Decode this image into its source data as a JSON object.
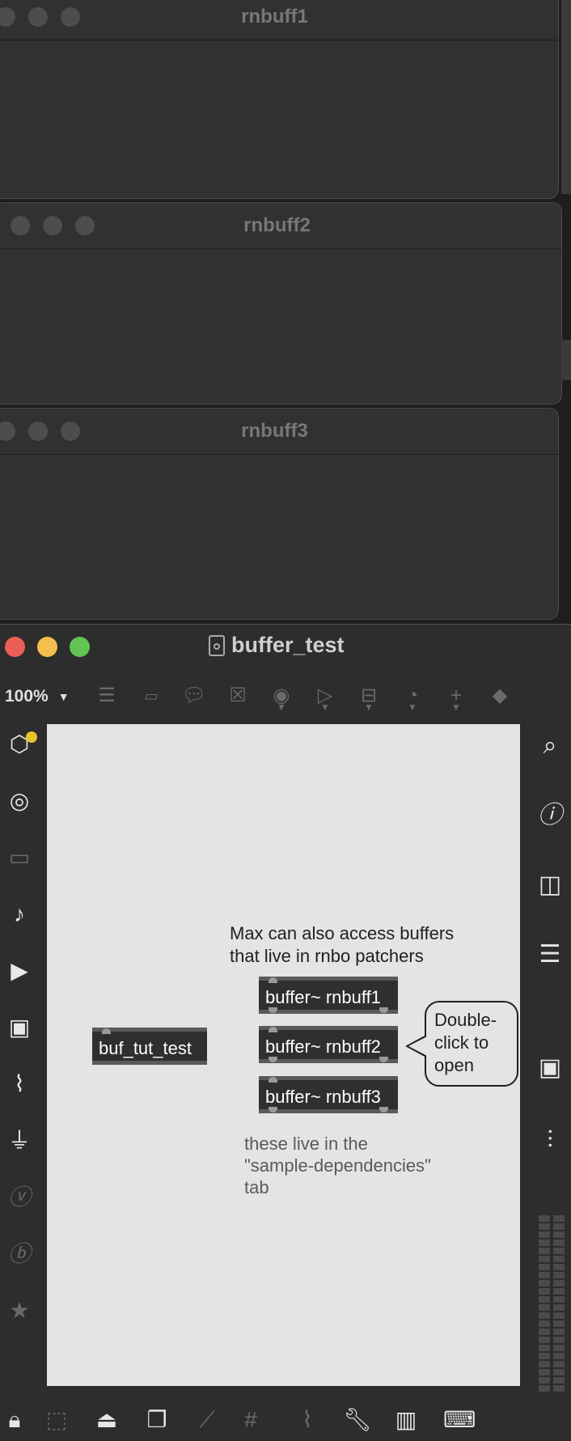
{
  "background_windows": [
    {
      "title": "rnbuff1"
    },
    {
      "title": "rnbuff2"
    },
    {
      "title": "rnbuff3"
    }
  ],
  "main_window": {
    "title": "buffer_test",
    "zoom": "100%",
    "zoom_arrow": "▼",
    "colors": {
      "close": "#ec5f57",
      "minimize": "#f4bf4f",
      "maximize": "#60c553"
    }
  },
  "toolbar_icons": [
    "object-box-icon",
    "message-box-icon",
    "comment-icon",
    "toggle-icon",
    "button-icon",
    "play-icon",
    "slider-icon",
    "dial-icon",
    "add-icon",
    "paint-bucket-icon"
  ],
  "left_sidebar_icons": [
    "packages-icon",
    "target-icon",
    "media-icon",
    "music-note-icon",
    "playlist-icon",
    "image-icon",
    "paperclip-icon",
    "plug-icon",
    "vizzie-icon",
    "bpatcher-icon",
    "star-icon"
  ],
  "right_sidebar_icons": [
    "search-icon",
    "info-icon",
    "book-icon",
    "list-icon",
    "camera-icon",
    "mixer-icon"
  ],
  "bottom_icons": [
    "lock-icon",
    "presentation-select-icon",
    "presentation-icon",
    "layers-icon",
    "snap-icon",
    "grid-icon",
    "attach-icon",
    "wrench-icon",
    "piano-icon",
    "keyboard-icon"
  ],
  "patch": {
    "comment_top": [
      "Max can also access buffers",
      "that live in rnbo patchers"
    ],
    "rnbo_object": "buf_tut_test",
    "buffers": [
      "buffer~ rnbuff1",
      "buffer~ rnbuff2",
      "buffer~ rnbuff3"
    ],
    "bubble": [
      "Double-",
      "click to",
      "open"
    ],
    "comment_bottom": [
      "these live in the",
      "\"sample-dependencies\"",
      "tab"
    ]
  }
}
